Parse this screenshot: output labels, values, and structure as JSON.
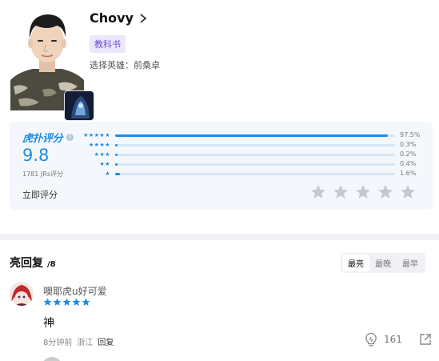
{
  "player": {
    "name": "Chovy",
    "tag": "教科书",
    "hero_line": "选择英雄：前桑卓"
  },
  "rating": {
    "logo_text": "虎扑评分",
    "score": "9.8",
    "count": "1781 JRs评分",
    "rate_now": "立即评分",
    "bars": [
      {
        "stars": "★★★★★",
        "percent": 97.5,
        "label": "97.5%"
      },
      {
        "stars": "★★★★",
        "percent": 0.3,
        "label": "0.3%"
      },
      {
        "stars": "★★★",
        "percent": 0.2,
        "label": "0.2%"
      },
      {
        "stars": "★★",
        "percent": 0.4,
        "label": "0.4%"
      },
      {
        "stars": "★",
        "percent": 1.6,
        "label": "1.6%"
      }
    ]
  },
  "comments": {
    "title": "亮回复",
    "count": "/8",
    "sort_options": [
      "最亮",
      "最晚",
      "最早"
    ],
    "active_sort": "最亮",
    "items": [
      {
        "user": "噢耶虎u好可爱",
        "user_rating": 5,
        "text": "神",
        "time": "8分钟前",
        "location": "浙江",
        "reply_label": "回复",
        "likes": "161"
      }
    ]
  },
  "colors": {
    "accent": "#1f8ce3",
    "tag_bg": "#ede6ff",
    "tag_text": "#6a4cc9"
  }
}
